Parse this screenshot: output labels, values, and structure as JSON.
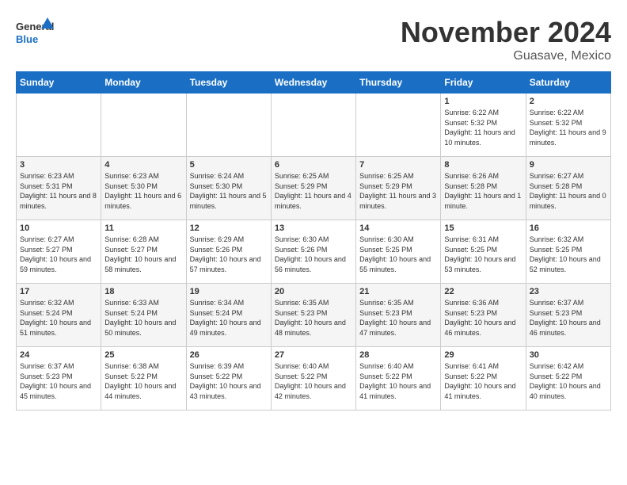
{
  "logo": {
    "line1": "General",
    "line2": "Blue"
  },
  "title": "November 2024",
  "subtitle": "Guasave, Mexico",
  "days_of_week": [
    "Sunday",
    "Monday",
    "Tuesday",
    "Wednesday",
    "Thursday",
    "Friday",
    "Saturday"
  ],
  "weeks": [
    [
      {
        "day": "",
        "info": ""
      },
      {
        "day": "",
        "info": ""
      },
      {
        "day": "",
        "info": ""
      },
      {
        "day": "",
        "info": ""
      },
      {
        "day": "",
        "info": ""
      },
      {
        "day": "1",
        "info": "Sunrise: 6:22 AM\nSunset: 5:32 PM\nDaylight: 11 hours and 10 minutes."
      },
      {
        "day": "2",
        "info": "Sunrise: 6:22 AM\nSunset: 5:32 PM\nDaylight: 11 hours and 9 minutes."
      }
    ],
    [
      {
        "day": "3",
        "info": "Sunrise: 6:23 AM\nSunset: 5:31 PM\nDaylight: 11 hours and 8 minutes."
      },
      {
        "day": "4",
        "info": "Sunrise: 6:23 AM\nSunset: 5:30 PM\nDaylight: 11 hours and 6 minutes."
      },
      {
        "day": "5",
        "info": "Sunrise: 6:24 AM\nSunset: 5:30 PM\nDaylight: 11 hours and 5 minutes."
      },
      {
        "day": "6",
        "info": "Sunrise: 6:25 AM\nSunset: 5:29 PM\nDaylight: 11 hours and 4 minutes."
      },
      {
        "day": "7",
        "info": "Sunrise: 6:25 AM\nSunset: 5:29 PM\nDaylight: 11 hours and 3 minutes."
      },
      {
        "day": "8",
        "info": "Sunrise: 6:26 AM\nSunset: 5:28 PM\nDaylight: 11 hours and 1 minute."
      },
      {
        "day": "9",
        "info": "Sunrise: 6:27 AM\nSunset: 5:28 PM\nDaylight: 11 hours and 0 minutes."
      }
    ],
    [
      {
        "day": "10",
        "info": "Sunrise: 6:27 AM\nSunset: 5:27 PM\nDaylight: 10 hours and 59 minutes."
      },
      {
        "day": "11",
        "info": "Sunrise: 6:28 AM\nSunset: 5:27 PM\nDaylight: 10 hours and 58 minutes."
      },
      {
        "day": "12",
        "info": "Sunrise: 6:29 AM\nSunset: 5:26 PM\nDaylight: 10 hours and 57 minutes."
      },
      {
        "day": "13",
        "info": "Sunrise: 6:30 AM\nSunset: 5:26 PM\nDaylight: 10 hours and 56 minutes."
      },
      {
        "day": "14",
        "info": "Sunrise: 6:30 AM\nSunset: 5:25 PM\nDaylight: 10 hours and 55 minutes."
      },
      {
        "day": "15",
        "info": "Sunrise: 6:31 AM\nSunset: 5:25 PM\nDaylight: 10 hours and 53 minutes."
      },
      {
        "day": "16",
        "info": "Sunrise: 6:32 AM\nSunset: 5:25 PM\nDaylight: 10 hours and 52 minutes."
      }
    ],
    [
      {
        "day": "17",
        "info": "Sunrise: 6:32 AM\nSunset: 5:24 PM\nDaylight: 10 hours and 51 minutes."
      },
      {
        "day": "18",
        "info": "Sunrise: 6:33 AM\nSunset: 5:24 PM\nDaylight: 10 hours and 50 minutes."
      },
      {
        "day": "19",
        "info": "Sunrise: 6:34 AM\nSunset: 5:24 PM\nDaylight: 10 hours and 49 minutes."
      },
      {
        "day": "20",
        "info": "Sunrise: 6:35 AM\nSunset: 5:23 PM\nDaylight: 10 hours and 48 minutes."
      },
      {
        "day": "21",
        "info": "Sunrise: 6:35 AM\nSunset: 5:23 PM\nDaylight: 10 hours and 47 minutes."
      },
      {
        "day": "22",
        "info": "Sunrise: 6:36 AM\nSunset: 5:23 PM\nDaylight: 10 hours and 46 minutes."
      },
      {
        "day": "23",
        "info": "Sunrise: 6:37 AM\nSunset: 5:23 PM\nDaylight: 10 hours and 46 minutes."
      }
    ],
    [
      {
        "day": "24",
        "info": "Sunrise: 6:37 AM\nSunset: 5:23 PM\nDaylight: 10 hours and 45 minutes."
      },
      {
        "day": "25",
        "info": "Sunrise: 6:38 AM\nSunset: 5:22 PM\nDaylight: 10 hours and 44 minutes."
      },
      {
        "day": "26",
        "info": "Sunrise: 6:39 AM\nSunset: 5:22 PM\nDaylight: 10 hours and 43 minutes."
      },
      {
        "day": "27",
        "info": "Sunrise: 6:40 AM\nSunset: 5:22 PM\nDaylight: 10 hours and 42 minutes."
      },
      {
        "day": "28",
        "info": "Sunrise: 6:40 AM\nSunset: 5:22 PM\nDaylight: 10 hours and 41 minutes."
      },
      {
        "day": "29",
        "info": "Sunrise: 6:41 AM\nSunset: 5:22 PM\nDaylight: 10 hours and 41 minutes."
      },
      {
        "day": "30",
        "info": "Sunrise: 6:42 AM\nSunset: 5:22 PM\nDaylight: 10 hours and 40 minutes."
      }
    ]
  ]
}
